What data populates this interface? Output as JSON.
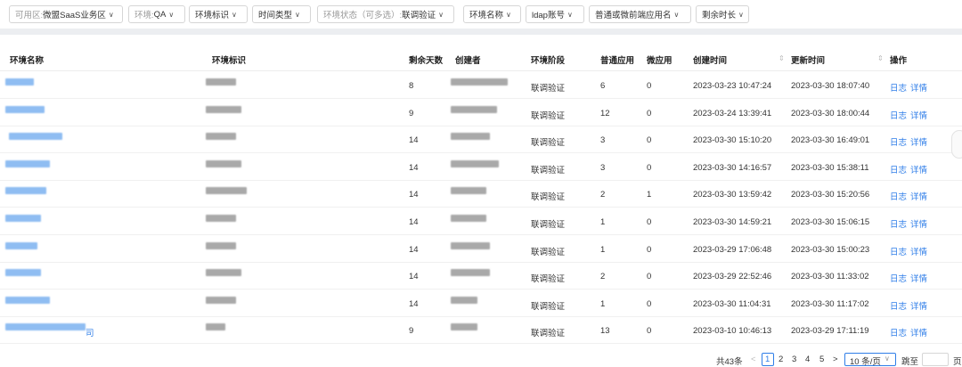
{
  "filters": [
    {
      "label": "可用区: ",
      "value": "微盟SaaS业务区"
    },
    {
      "label": "环境: ",
      "value": "QA"
    },
    {
      "label": "",
      "value": "环境标识"
    },
    {
      "label": "",
      "value": "时间类型"
    },
    {
      "label": "环境状态（可多选）: ",
      "value": "联调验证"
    },
    {
      "label": "",
      "value": "环境名称"
    },
    {
      "label": "",
      "value": "ldap账号"
    },
    {
      "label": "",
      "value": "普通或微前端应用名"
    },
    {
      "label": "",
      "value": "剩余时长"
    }
  ],
  "table": {
    "headers": [
      "环境名称",
      "环境标识",
      "剩余天数",
      "创建者",
      "环境阶段",
      "普通应用",
      "微应用",
      "创建时间",
      "更新时间",
      "操作"
    ],
    "rows": [
      {
        "days": "8",
        "stage": "联调验证",
        "normal": "6",
        "micro": "0",
        "created": "2023-03-23 10:47:24",
        "updated": "2023-03-30 18:07:40"
      },
      {
        "days": "9",
        "stage": "联调验证",
        "normal": "12",
        "micro": "0",
        "created": "2023-03-24 13:39:41",
        "updated": "2023-03-30 18:00:44"
      },
      {
        "days": "14",
        "stage": "联调验证",
        "normal": "3",
        "micro": "0",
        "created": "2023-03-30 15:10:20",
        "updated": "2023-03-30 16:49:01"
      },
      {
        "days": "14",
        "stage": "联调验证",
        "normal": "3",
        "micro": "0",
        "created": "2023-03-30 14:16:57",
        "updated": "2023-03-30 15:38:11"
      },
      {
        "days": "14",
        "stage": "联调验证",
        "normal": "2",
        "micro": "1",
        "created": "2023-03-30 13:59:42",
        "updated": "2023-03-30 15:20:56"
      },
      {
        "days": "14",
        "stage": "联调验证",
        "normal": "1",
        "micro": "0",
        "created": "2023-03-30 14:59:21",
        "updated": "2023-03-30 15:06:15"
      },
      {
        "days": "14",
        "stage": "联调验证",
        "normal": "1",
        "micro": "0",
        "created": "2023-03-29 17:06:48",
        "updated": "2023-03-30 15:00:23"
      },
      {
        "days": "14",
        "stage": "联调验证",
        "normal": "2",
        "micro": "0",
        "created": "2023-03-29 22:52:46",
        "updated": "2023-03-30 11:33:02"
      },
      {
        "days": "14",
        "stage": "联调验证",
        "normal": "1",
        "micro": "0",
        "created": "2023-03-30 11:04:31",
        "updated": "2023-03-30 11:17:02"
      },
      {
        "days": "9",
        "stage": "联调验证",
        "normal": "13",
        "micro": "0",
        "created": "2023-03-10 10:46:13",
        "updated": "2023-03-29 17:11:19"
      }
    ],
    "actions": {
      "log": "日志",
      "detail": "详情"
    },
    "last_name_suffix": "司"
  },
  "pagination": {
    "total": "共43条",
    "prev": "<",
    "pages": [
      "1",
      "2",
      "3",
      "4",
      "5"
    ],
    "next": ">",
    "page_size": "10 条/页",
    "jump_label": "跳至",
    "page_unit": "页"
  },
  "colors": {
    "accent": "#2f7ee8"
  }
}
